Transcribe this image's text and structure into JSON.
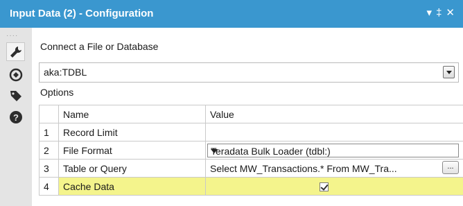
{
  "window": {
    "title": "Input Data (2) - Configuration"
  },
  "sidebar": {
    "icons": [
      "wrench-icon",
      "navigate-icon",
      "tag-icon",
      "help-icon"
    ]
  },
  "connect": {
    "label": "Connect a File or Database",
    "value": "aka:TDBL"
  },
  "options": {
    "label": "Options",
    "headers": [
      "Name",
      "Value"
    ],
    "rows": [
      {
        "num": "1",
        "name": "Record Limit",
        "value": ""
      },
      {
        "num": "2",
        "name": "File Format",
        "value": "Teradata Bulk Loader (tdbl:)"
      },
      {
        "num": "3",
        "name": "Table or Query",
        "value": "Select MW_Transactions.* From MW_Tra...",
        "button": "..."
      },
      {
        "num": "4",
        "name": "Cache Data",
        "value": "",
        "checked": true
      }
    ]
  },
  "colors": {
    "titlebar": "#3a97cf",
    "highlight": "#f4f48c"
  }
}
